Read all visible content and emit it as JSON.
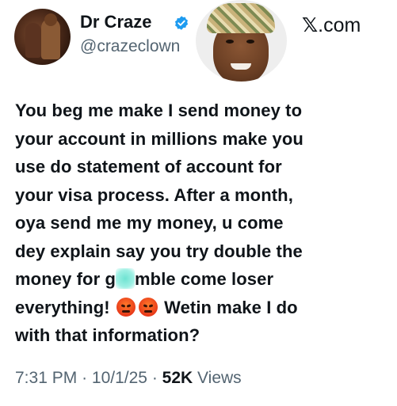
{
  "author": {
    "display_name": "Dr Craze",
    "handle": "@crazeclown",
    "verified_icon": "verified-badge-icon",
    "verified_color": "#1d9bf0"
  },
  "brand": {
    "label": ".com",
    "glyph": "𝕏"
  },
  "tweet": {
    "text_a": "You beg me make I send money to\nyour account in millions make you\nuse do statement of account for\nyour visa process. After a month,\noya send me my money, u come\ndey explain say you try double the\nmoney for g",
    "text_b": "mble come loser\neverything! ",
    "text_c": " Wetin make I do\nwith that information?",
    "emoji": "angry-face-icon"
  },
  "meta": {
    "time": "7:31 PM",
    "date": "10/1/25",
    "views_count": "52K",
    "views_label": "Views",
    "separator": "·"
  },
  "colors": {
    "text": "#0f1419",
    "secondary": "#536471",
    "accent": "#1d9bf0"
  }
}
